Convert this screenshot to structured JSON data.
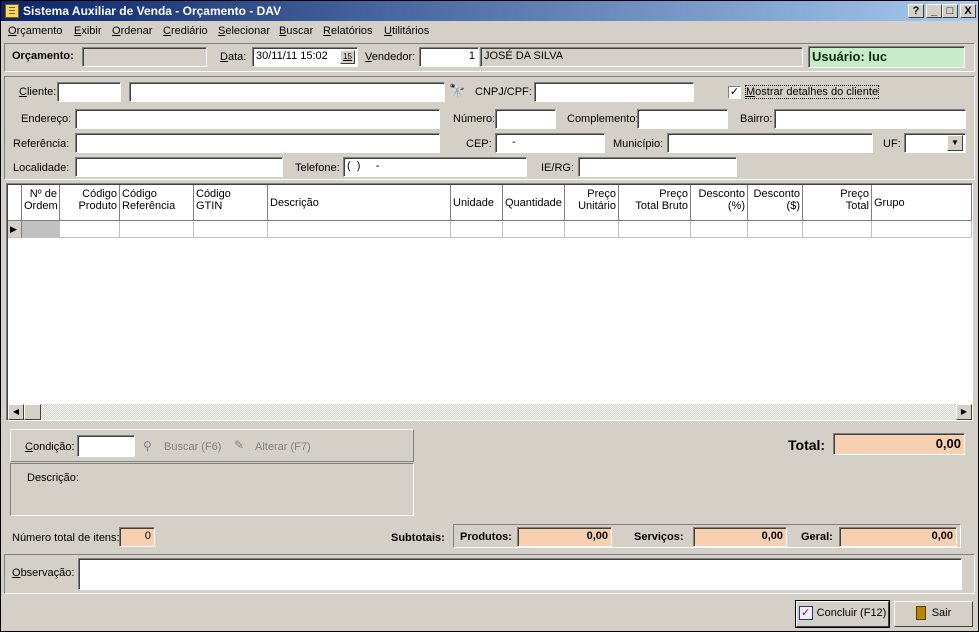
{
  "window": {
    "title": "Sistema Auxiliar de Venda - Orçamento - DAV",
    "help_btn": "?",
    "min_btn": "_",
    "max_btn": "□",
    "close_btn": "X"
  },
  "menu": [
    "Orçamento",
    "Exibir",
    "Ordenar",
    "Crediário",
    "Selecionar",
    "Buscar",
    "Relatórios",
    "Utilitários"
  ],
  "header": {
    "orcamento_label": "Orçamento:",
    "orcamento_value": "",
    "data_label": "Data:",
    "data_value": "30/11/11 15:02",
    "calendar_glyph": "15",
    "vendedor_label": "Vendedor:",
    "vendedor_code": "1",
    "vendedor_name": "JOSÉ DA SILVA",
    "usuario": "Usuário: luc"
  },
  "cliente": {
    "cliente_label": "Cliente:",
    "cliente_code": "",
    "cliente_name": "",
    "binoculars_glyph": "🔭",
    "cnpj_label": "CNPJ/CPF:",
    "cnpj_value": "",
    "mostrar_label": "Mostrar detalhes do cliente",
    "mostrar_checked": "✓",
    "endereco_label": "Endereço:",
    "numero_label": "Número:",
    "complemento_label": "Complemento:",
    "bairro_label": "Bairro:",
    "referencia_label": "Referência:",
    "cep_label": "CEP:",
    "cep_value": "-",
    "municipio_label": "Município:",
    "uf_label": "UF:",
    "uf_value": "",
    "localidade_label": "Localidade:",
    "telefone_label": "Telefone:",
    "telefone_value": "(  )     -",
    "ie_label": "IE/RG:"
  },
  "grid": {
    "columns": [
      {
        "l1": "Nº de",
        "l2": "Ordem",
        "align": "right"
      },
      {
        "l1": "Código",
        "l2": "Produto",
        "align": "right"
      },
      {
        "l1": "Código",
        "l2": "Referência",
        "align": "left"
      },
      {
        "l1": "Código",
        "l2": "GTIN",
        "align": "left"
      },
      {
        "l1": "Descrição",
        "l2": "",
        "align": "left"
      },
      {
        "l1": "Unidade",
        "l2": "",
        "align": "left"
      },
      {
        "l1": "Quantidade",
        "l2": "",
        "align": "left"
      },
      {
        "l1": "Preço",
        "l2": "Unitário",
        "align": "right"
      },
      {
        "l1": "Preço",
        "l2": "Total Bruto",
        "align": "right"
      },
      {
        "l1": "Desconto",
        "l2": "(%)",
        "align": "right"
      },
      {
        "l1": "Desconto",
        "l2": "($)",
        "align": "right"
      },
      {
        "l1": "Preço",
        "l2": "Total",
        "align": "right"
      },
      {
        "l1": "Grupo",
        "l2": "",
        "align": "left"
      }
    ],
    "row_pointer": "▶"
  },
  "condicao": {
    "label": "Condição:",
    "value": "",
    "buscar": "Buscar (F6)",
    "alterar": "Alterar (F7)",
    "descricao_label": "Descrição:"
  },
  "totals": {
    "total_label": "Total:",
    "total_value": "0,00",
    "num_itens_label": "Número total de itens:",
    "num_itens_value": "0",
    "subtotais_label": "Subtotais:",
    "produtos_label": "Produtos:",
    "produtos_value": "0,00",
    "servicos_label": "Serviços:",
    "servicos_value": "0,00",
    "geral_label": "Geral:",
    "geral_value": "0,00"
  },
  "observacao": {
    "label": "Observação:",
    "value": ""
  },
  "buttons": {
    "concluir": "Concluir (F12)",
    "sair": "Sair"
  },
  "colors": {
    "title_start": "#0a246a",
    "title_end": "#a6caf0",
    "face": "#d4d0c8",
    "peach": "#f7cfb1",
    "user_green": "#c8ecc8"
  }
}
